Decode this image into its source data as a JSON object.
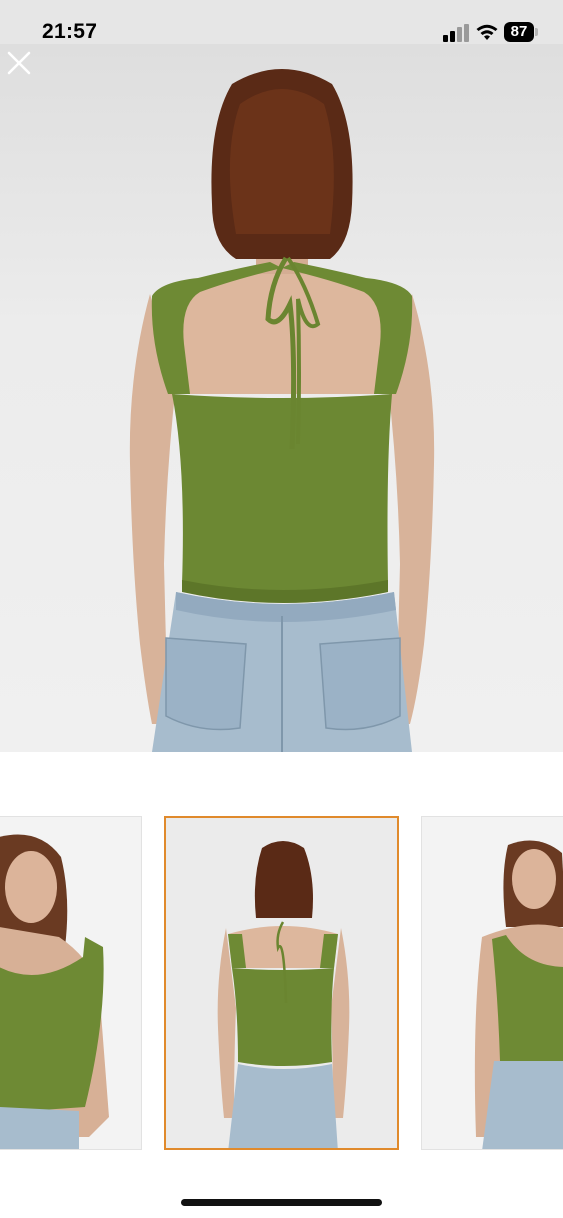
{
  "status_bar": {
    "time": "21:57",
    "battery": "87",
    "icons": [
      "signal-icon",
      "wifi-icon",
      "battery-icon"
    ]
  },
  "viewer": {
    "close_icon": "close-icon",
    "main_image": "product-photo-back-view",
    "thumbnails": [
      {
        "name": "product-photo-front-angle",
        "selected": false
      },
      {
        "name": "product-photo-back-view",
        "selected": true
      },
      {
        "name": "product-photo-front-view",
        "selected": false
      }
    ]
  },
  "colors": {
    "accent": "#e08a2c",
    "garment": "#6e8a34",
    "denim": "#a7bccd"
  }
}
